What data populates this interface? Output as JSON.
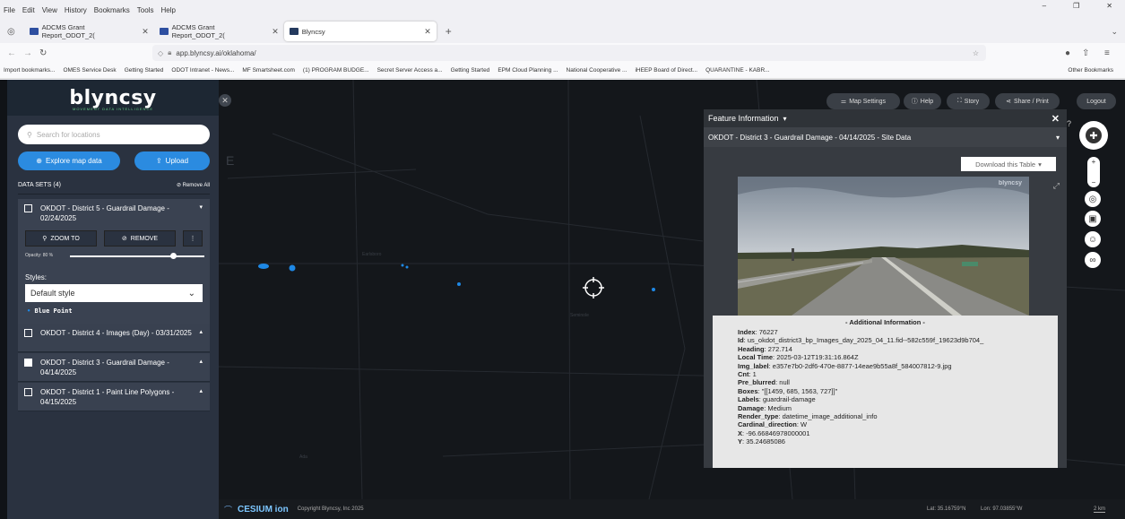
{
  "browser": {
    "menu": [
      "File",
      "Edit",
      "View",
      "History",
      "Bookmarks",
      "Tools",
      "Help"
    ],
    "tabs": [
      {
        "label": "ADCMS Grant Report_ODOT_2("
      },
      {
        "label": "ADCMS Grant Report_ODOT_2("
      },
      {
        "label": "Blyncsy"
      }
    ],
    "url": "app.blyncsy.ai/oklahoma/",
    "bookmarks": [
      "Import bookmarks...",
      "OMES Service Desk",
      "Getting Started",
      "ODOT Intranet - News...",
      "MF Smartsheet.com",
      "(1) PROGRAM BUDGE...",
      "Secret Server Access a...",
      "Getting Started",
      "EPM Cloud Planning ...",
      "National Cooperative ...",
      "iHEEP Board of Direct...",
      "QUARANTINE - KABR...",
      "Other Bookmarks"
    ]
  },
  "sidebar": {
    "logo": "blyncsy",
    "logo_tagline": "MOVEMENT DATA INTELLIGENCE",
    "search_placeholder": "Search for locations",
    "explore_label": "Explore map data",
    "upload_label": "Upload",
    "datasets_header": "DATA SETS (4)",
    "remove_all": "Remove All",
    "datasets": [
      {
        "name": "OKDOT - District 5 - Guardrail Damage - 02/24/2025",
        "checked": false
      },
      {
        "name": "OKDOT - District 4 - Images (Day) - 03/31/2025",
        "checked": false
      },
      {
        "name": "OKDOT - District 3 - Guardrail Damage - 04/14/2025",
        "checked": true
      },
      {
        "name": "OKDOT - District 1 - Paint Line Polygons - 04/15/2025",
        "checked": false
      }
    ],
    "zoom_to": "ZOOM TO",
    "remove": "REMOVE",
    "opacity_label": "Opacity: 80 %",
    "opacity_value": 0.8,
    "styles_label": "Styles:",
    "style_value": "Default style",
    "legend_label": "Blue Point"
  },
  "toolbar": {
    "map_settings": "Map Settings",
    "help": "Help",
    "story": "Story",
    "share": "Share / Print",
    "logout": "Logout"
  },
  "feature": {
    "title": "Feature Information",
    "subtitle": "OKDOT - District 3 - Guardrail Damage - 04/14/2025 - Site Data",
    "download": "Download this Table",
    "watermark": "blyncsy",
    "info_title": "- Additional Information -",
    "rows": [
      {
        "k": "Index",
        "v": "76227"
      },
      {
        "k": "Id",
        "v": "us_okdot_district3_bp_Images_day_2025_04_11.fid--582c559f_19623d9b704_"
      },
      {
        "k": "Heading",
        "v": "272.714"
      },
      {
        "k": "Local Time",
        "v": "2025-03-12T19:31:16.864Z"
      },
      {
        "k": "Img_label",
        "v": "e357e7b0-2df6-470e-8877-14eae9b55a8f_584007812-9.jpg"
      },
      {
        "k": "Cnt",
        "v": "1"
      },
      {
        "k": "Pre_blurred",
        "v": "null"
      },
      {
        "k": "Boxes",
        "v": "\"[[1459, 685, 1563, 727]]\""
      },
      {
        "k": "Labels",
        "v": "guardrail-damage"
      },
      {
        "k": "Damage",
        "v": "Medium"
      },
      {
        "k": "Render_type",
        "v": "datetime_image_additional_info"
      },
      {
        "k": "Cardinal_direction",
        "v": "W"
      },
      {
        "k": "X",
        "v": "-96.66846978000001"
      },
      {
        "k": "Y",
        "v": "35.24685086"
      }
    ]
  },
  "footer": {
    "cesium": "CESIUM ion",
    "copyright": "Copyright Blyncsy, Inc 2025",
    "lat": "Lat: 35.16759°N",
    "lon": "Lon: 97.03855°W",
    "scale": "2 km"
  },
  "colors": {
    "accent": "#2b8be0",
    "sidebar": "#2a3240",
    "map": "#14171b"
  }
}
